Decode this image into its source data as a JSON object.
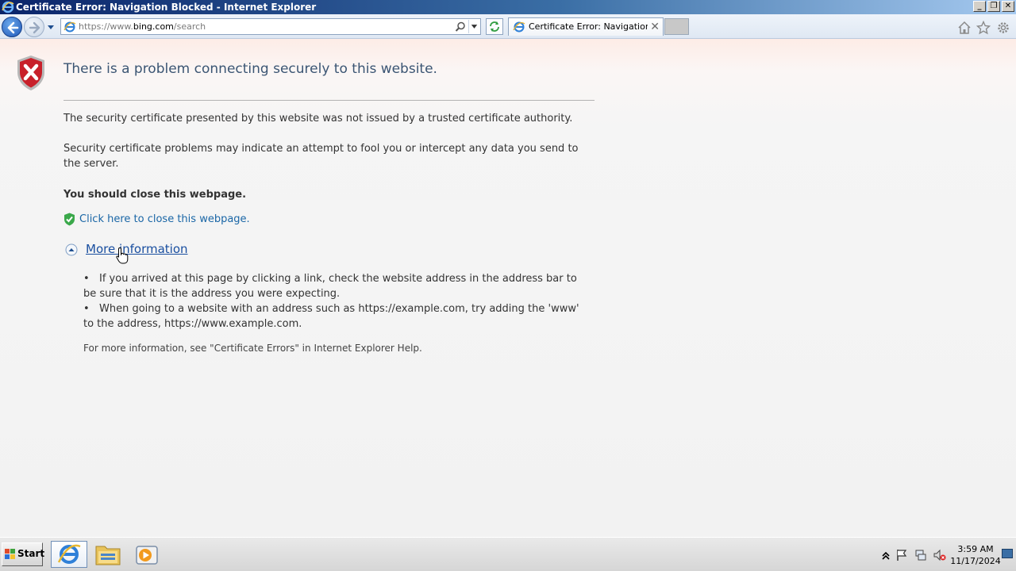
{
  "window": {
    "title": "Certificate Error: Navigation Blocked - Internet Explorer",
    "controls": {
      "minimize": "_",
      "restore": "❐",
      "close": "✕"
    }
  },
  "navbar": {
    "address_url_prefix": "https://www.",
    "address_url_domain": "bing.com",
    "address_url_suffix": "/search",
    "tab_label": "Certificate Error: Navigation ...",
    "tab_close": "✕",
    "icons": [
      "back-arrow-icon",
      "forward-arrow-icon",
      "search-icon",
      "refresh-icon",
      "home-icon",
      "favorites-star-icon",
      "tools-gear-icon"
    ]
  },
  "content": {
    "headline": "There is a problem connecting securely to this website.",
    "para1": "The security certificate presented by this website was not issued by a trusted certificate authority.",
    "para2": "Security certificate problems may indicate an attempt to fool you or intercept any data you send to the server.",
    "recommendation": "You should close this webpage.",
    "close_link": "Click here to close this webpage.",
    "more_info_link": "More information",
    "bullets": [
      "If you arrived at this page by clicking a link, check the website address in the address bar to be sure that it is the address you were expecting.",
      "When going to a website with an address such as https://example.com, try adding the 'www' to the address, https://www.example.com."
    ],
    "help_note": "For more information, see \"Certificate Errors\" in Internet Explorer Help."
  },
  "taskbar": {
    "start_label": "Start",
    "clock_time": "3:59 AM",
    "clock_date": "11/17/2024"
  },
  "colors": {
    "headline": "#3b5573",
    "link": "#1a66a6",
    "shield_red": "#c8202a"
  }
}
